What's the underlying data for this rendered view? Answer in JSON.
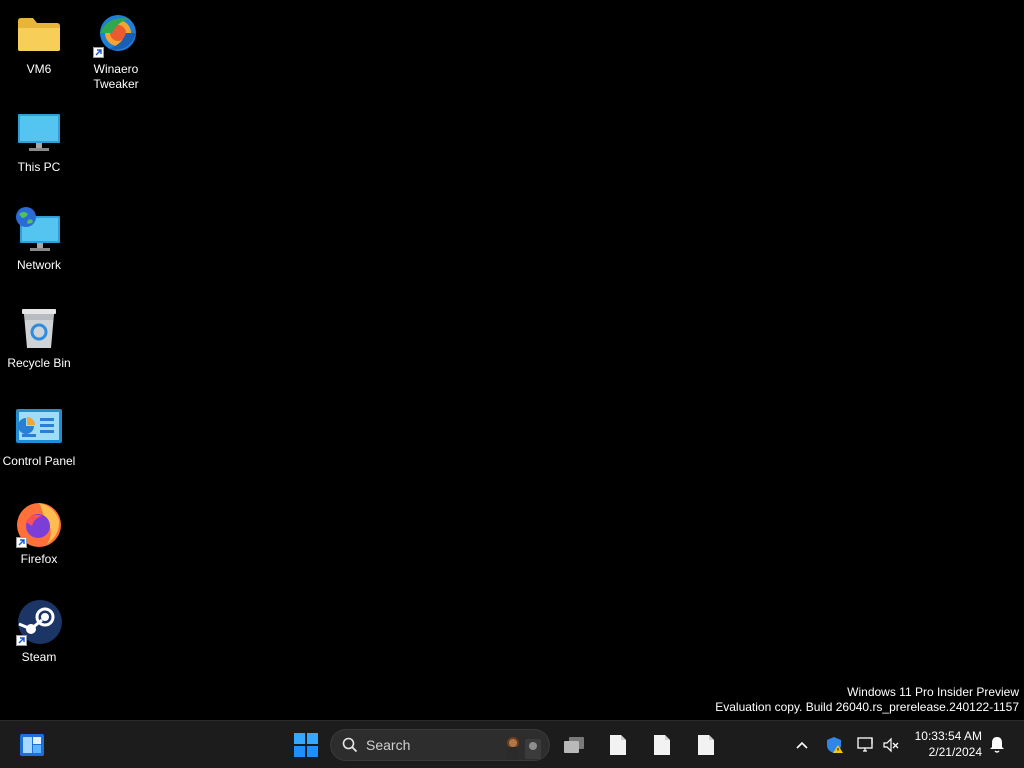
{
  "desktop": {
    "icons": [
      {
        "label": "VM6",
        "icon": "folder-icon"
      },
      {
        "label": "Winaero\nTweaker",
        "icon": "winaero-tweaker-icon"
      },
      {
        "label": "This PC",
        "icon": "monitor-icon"
      },
      {
        "label": "Network",
        "icon": "network-globe-icon"
      },
      {
        "label": "Recycle Bin",
        "icon": "recycle-bin-icon"
      },
      {
        "label": "Control Panel",
        "icon": "control-panel-icon"
      },
      {
        "label": "Firefox",
        "icon": "firefox-icon"
      },
      {
        "label": "Steam",
        "icon": "steam-icon"
      }
    ]
  },
  "watermark": {
    "line1": "Windows 11 Pro Insider Preview",
    "line2": "Evaluation copy. Build 26040.rs_prerelease.240122-1157"
  },
  "taskbar": {
    "search_placeholder": "Search",
    "clock_time": "10:33:54 AM",
    "clock_date": "2/21/2024"
  },
  "colors": {
    "accent": "#0a84ff",
    "taskbar_bg": "#1c1c1c",
    "desktop_bg": "#000000"
  }
}
